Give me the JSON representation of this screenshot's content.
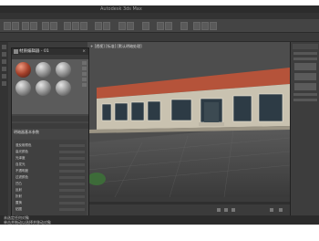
{
  "app": {
    "title": "Autodesk 3ds Max"
  },
  "menubar": {
    "items": [
      "文件",
      "编辑",
      "工具",
      "组",
      "视图",
      "创建",
      "修改器",
      "动画",
      "图形编辑器",
      "渲染",
      "Civil View",
      "自定义",
      "脚本",
      "帮助"
    ]
  },
  "viewport": {
    "label": "+ [透视] [标准] [默认明暗处理]"
  },
  "material_editor": {
    "title": "材质编辑器 - 01",
    "close_label": "×",
    "section_label": "明暗器基本参数",
    "params": [
      {
        "label": "漫反射颜色"
      },
      {
        "label": "高光颜色"
      },
      {
        "label": "光泽度"
      },
      {
        "label": "自发光"
      },
      {
        "label": "不透明度"
      },
      {
        "label": "过滤颜色"
      },
      {
        "label": "凹凸"
      },
      {
        "label": "反射"
      },
      {
        "label": "折射"
      },
      {
        "label": "置换"
      },
      {
        "label": "贴图"
      }
    ]
  },
  "status": {
    "line1": "未选定任何对象",
    "line2": "单击并拖动以选择并移动对象"
  },
  "colors": {
    "roof": "#b5533a",
    "wall": "#c9c2b0",
    "sky": "#4f4f4f"
  }
}
